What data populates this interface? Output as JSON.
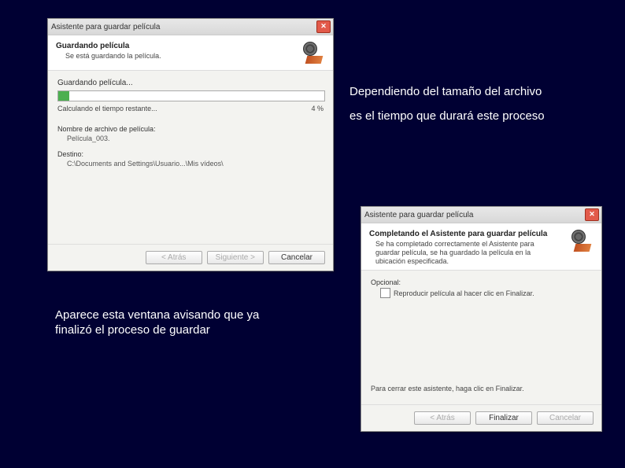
{
  "dialog1": {
    "title": "Asistente para guardar película",
    "header_title": "Guardando película",
    "header_sub": "Se está guardando la película.",
    "progress_label": "Guardando película...",
    "time_remaining": "Calculando el tiempo restante...",
    "percent": "4 %",
    "filename_label": "Nombre de archivo de película:",
    "filename_value": "Película_003.",
    "dest_label": "Destino:",
    "dest_value": "C:\\Documents and Settings\\Usuario...\\Mis vídeos\\",
    "btn_back": "< Atrás",
    "btn_next": "Siguiente >",
    "btn_cancel": "Cancelar"
  },
  "dialog2": {
    "title": "Asistente para guardar película",
    "header_title": "Completando el Asistente para guardar película",
    "header_sub": "Se ha completado correctamente el Asistente para guardar película, se ha guardado la película en la ubicación especificada.",
    "optional_label": "Opcional:",
    "checkbox_label": "Reproducir película al hacer clic en Finalizar.",
    "footer_note": "Para cerrar este asistente, haga clic en Finalizar.",
    "btn_back": "< Atrás",
    "btn_finish": "Finalizar",
    "btn_cancel": "Cancelar"
  },
  "caption1_line1": "Dependiendo del tamaño del archivo",
  "caption1_line2": "es el tiempo que durará este proceso",
  "caption2_line1": "Aparece esta ventana avisando que ya",
  "caption2_line2": "finalizó el proceso de guardar"
}
